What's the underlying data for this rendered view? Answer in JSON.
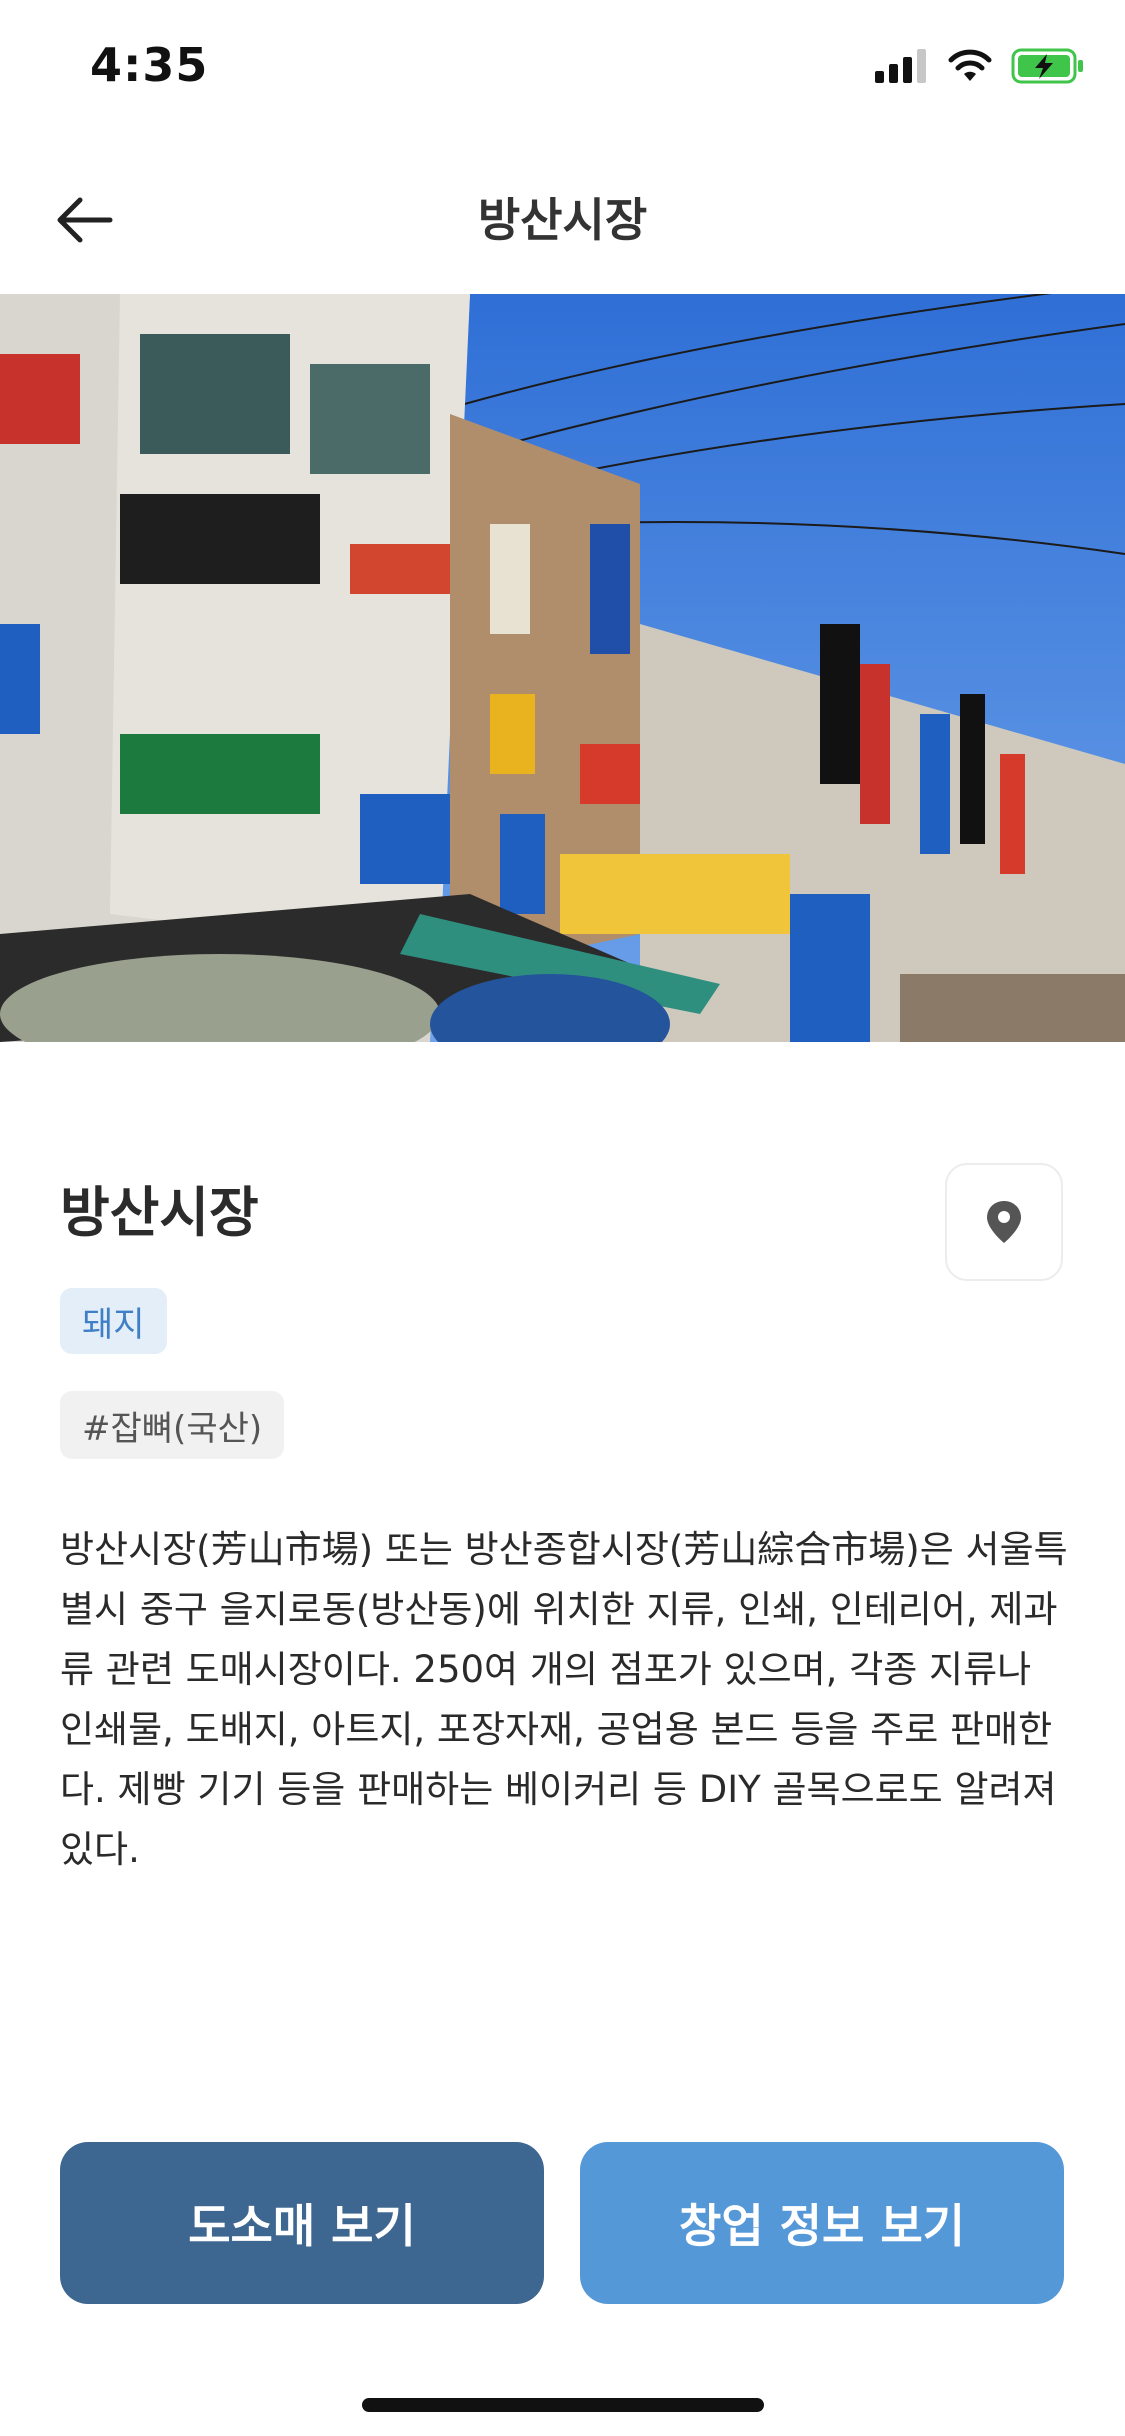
{
  "status_bar": {
    "time": "4:35"
  },
  "header": {
    "title": "방산시장"
  },
  "place": {
    "name": "방산시장",
    "category": "돼지",
    "tag": "#잡뼈(국산)",
    "description": "방산시장(芳山市場) 또는 방산종합시장(芳山綜合市場)은 서울특별시 중구 을지로동(방산동)에 위치한 지류, 인쇄, 인테리어, 제과류 관련 도매시장이다. 250여 개의 점포가 있으며, 각종 지류나 인쇄물, 도배지, 아트지, 포장자재, 공업용 본드 등을 주로 판매한다. 제빵 기기 등을 판매하는 베이커리 등 DIY 골목으로도 알려져 있다."
  },
  "actions": {
    "wholesale_label": "도소매 보기",
    "startup_label": "창업 정보 보기"
  },
  "icons": {
    "back": "arrow-left-icon",
    "map": "location-pin-icon",
    "signal": "signal-icon",
    "wifi": "wifi-icon",
    "battery": "battery-charging-icon"
  },
  "colors": {
    "primary_dark": "#3d6690",
    "primary_light": "#5598d7",
    "chip_bg": "#e3eef9",
    "chip_text": "#3f7fc6",
    "battery_green": "#3fc54a"
  }
}
